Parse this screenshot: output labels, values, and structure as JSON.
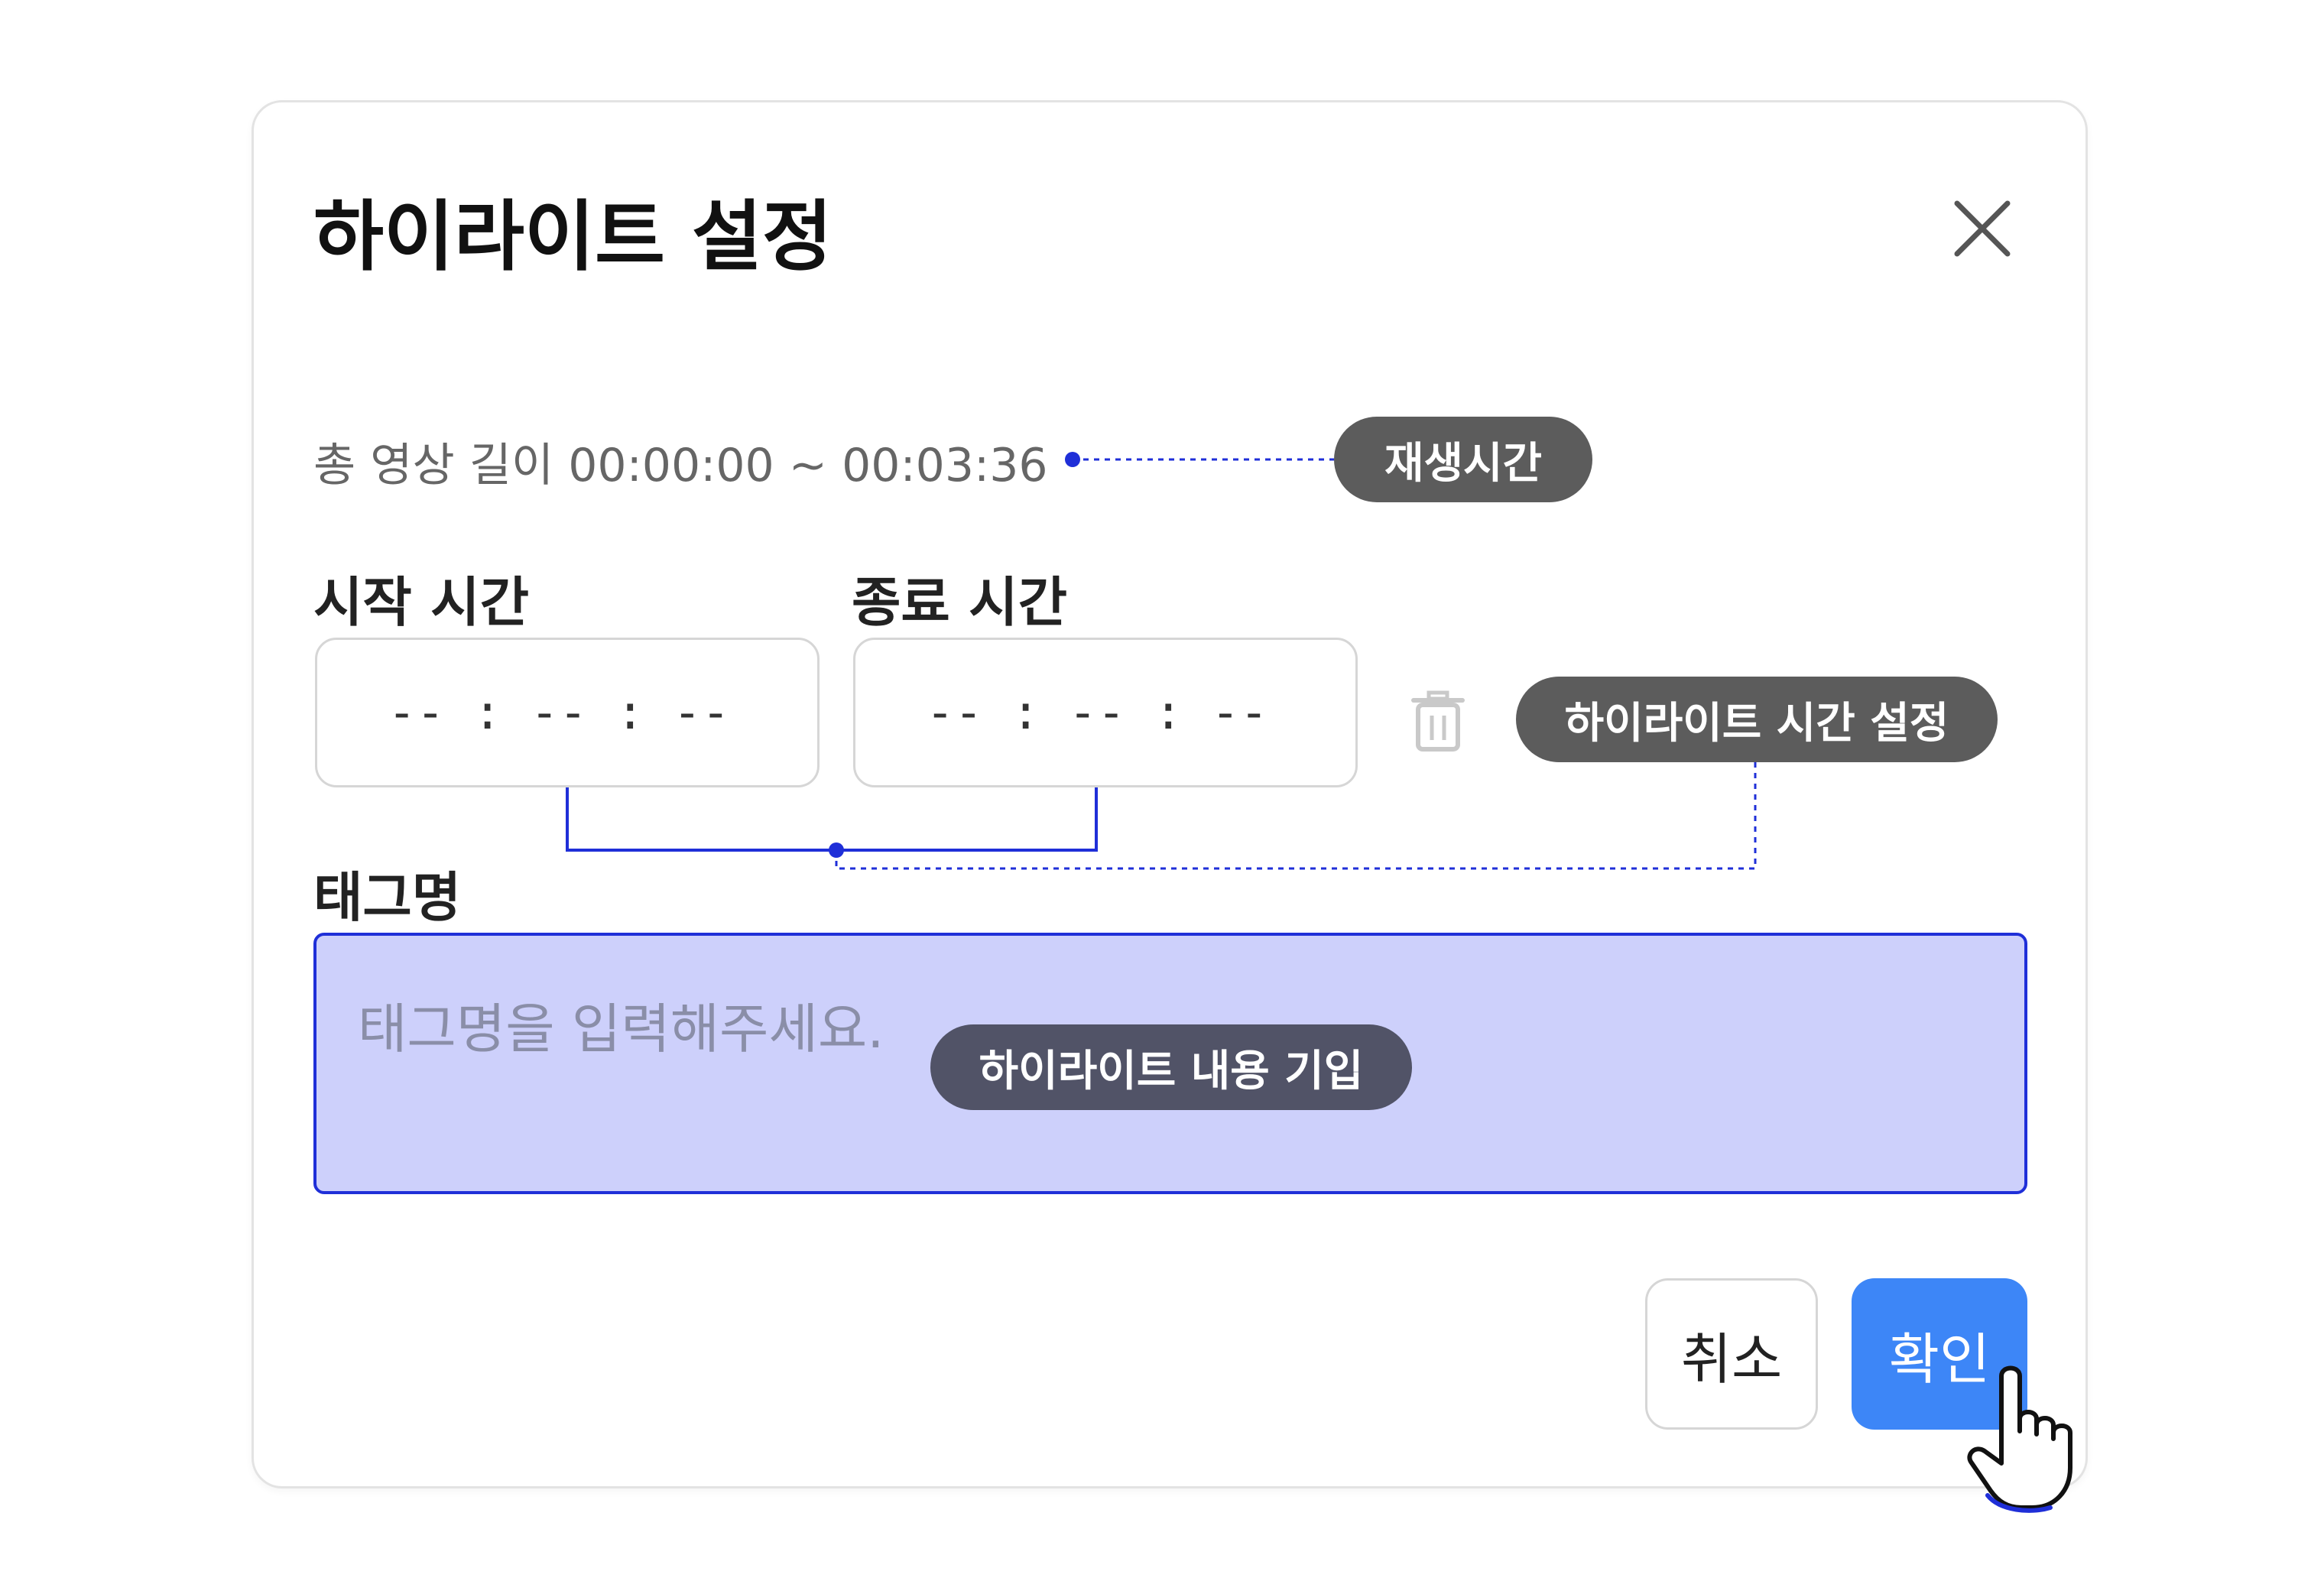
{
  "dialog": {
    "title": "하이라이트 설정",
    "close_icon": "close-icon",
    "duration_text": "총 영상 길이 00:00:00 ~ 00:03:36",
    "start_label": "시작 시간",
    "end_label": "종료 시간",
    "start_value": "-- : -- : --",
    "end_value": "-- : -- : --",
    "trash_icon": "trash-icon",
    "tag_label": "태그명",
    "tag_placeholder": "태그명을 입력해주세요.",
    "cancel_label": "취소",
    "confirm_label": "확인"
  },
  "annotations": {
    "playback_time": "재생시간",
    "highlight_time_setting": "하이라이트 시간 설정",
    "highlight_content_entry": "하이라이트 내용 기입"
  },
  "colors": {
    "confirm_button": "#3d86f7",
    "tag_area_fill": "#cdd0fb",
    "tag_area_border": "#1f2fd8",
    "annotation_line": "#1f2fd8",
    "pill_gray": "#5c5c5c",
    "pill_slate": "#515367"
  },
  "cursor": {
    "icon": "hand-pointer-icon"
  }
}
